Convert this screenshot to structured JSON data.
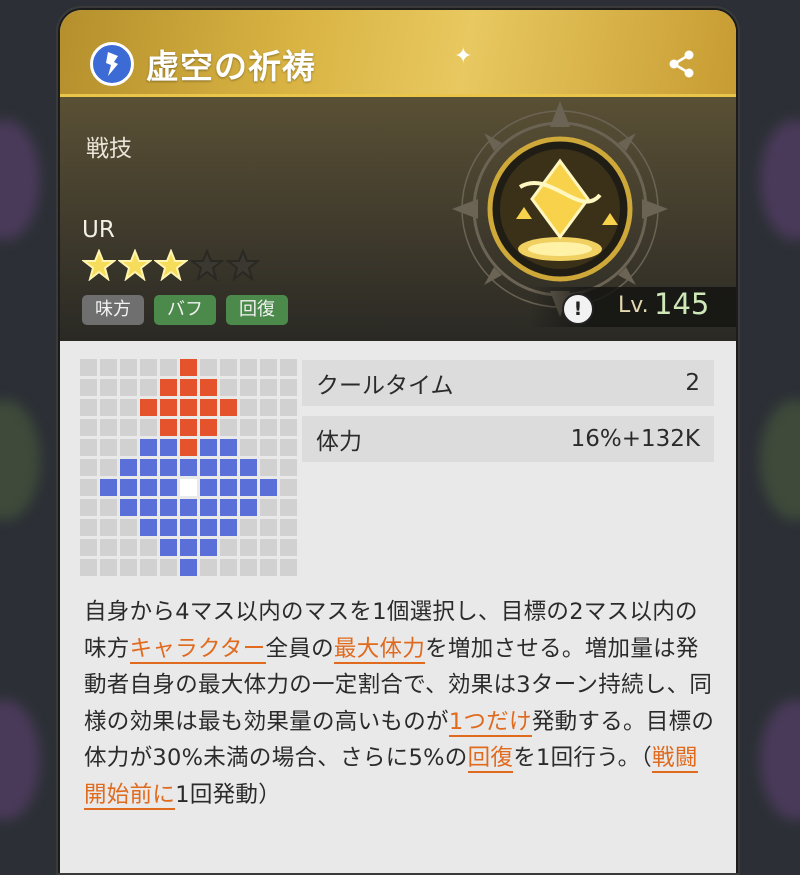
{
  "skill": {
    "title": "虚空の祈祷",
    "category": "戦技",
    "rarity": "UR",
    "stars_filled": 3,
    "stars_total": 5,
    "tags": [
      {
        "label": "味方",
        "style": "gray"
      },
      {
        "label": "バフ",
        "style": "green"
      },
      {
        "label": "回復",
        "style": "green"
      }
    ],
    "level_label": "Lv.",
    "level_value": "145",
    "info_icon": "!"
  },
  "stats": [
    {
      "label": "クールタイム",
      "value": "2"
    },
    {
      "label": "体力",
      "value": "16%+132K"
    }
  ],
  "range_grid": {
    "size": 11,
    "center": [
      5,
      6
    ],
    "target_color": "#e4532b",
    "select_color": "#5b6fd8",
    "empty_color": "#d1d1d1",
    "center_color": "#ffffff"
  },
  "description": [
    {
      "t": "自身から4マス以内のマスを1個選択し、目標の2マス以内の味方"
    },
    {
      "t": "キャラクター",
      "kw": true
    },
    {
      "t": "全員の"
    },
    {
      "t": "最大体力",
      "kw": true
    },
    {
      "t": "を増加させる。増加量は発動者自身の最大体力の一定割合で、効果は3ターン持続し、同様の効果は最も効果量の高いものが"
    },
    {
      "t": "1つだけ",
      "kw": true
    },
    {
      "t": "発動する。目標の体力が30%未満の場合、さらに5%の"
    },
    {
      "t": "回復",
      "kw": true
    },
    {
      "t": "を1回行う。（"
    },
    {
      "t": "戦闘開始前に",
      "kw": true
    },
    {
      "t": "1回発動）"
    }
  ],
  "colors": {
    "keyword": "#e06a1e",
    "title_gold": "#d9b443",
    "icon_blue": "#3d6bd6"
  }
}
